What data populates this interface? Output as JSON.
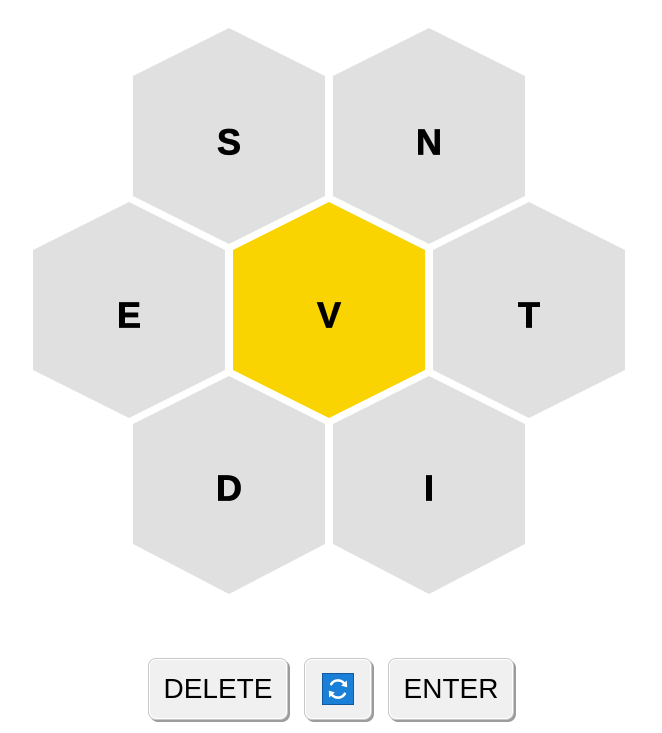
{
  "puzzle": {
    "center_letter": "V",
    "outer_letters": [
      "S",
      "N",
      "E",
      "T",
      "D",
      "I"
    ]
  },
  "colors": {
    "center_fill": "#fad400",
    "outer_fill": "#e0e0e0",
    "shuffle_icon_bg": "#1a7fd6"
  },
  "controls": {
    "delete_label": "DELETE",
    "shuffle_icon": "shuffle-icon",
    "enter_label": "ENTER"
  }
}
